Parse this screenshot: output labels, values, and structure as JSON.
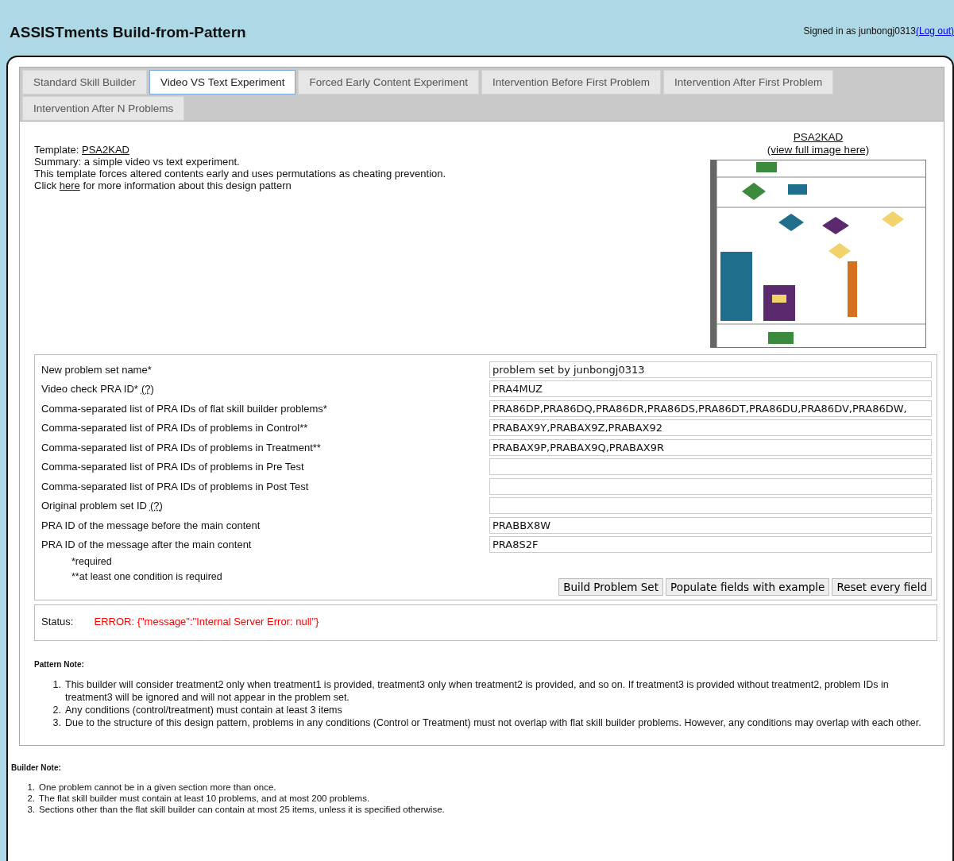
{
  "header": {
    "title": "ASSISTments Build-from-Pattern",
    "signed_in": "Signed in as junbongj0313",
    "logout": "(Log out)"
  },
  "tabs": [
    {
      "label": "Standard Skill Builder",
      "selected": false
    },
    {
      "label": "Video VS Text Experiment",
      "selected": true
    },
    {
      "label": "Forced Early Content Experiment",
      "selected": false
    },
    {
      "label": "Intervention Before First Problem",
      "selected": false
    },
    {
      "label": "Intervention After First Problem",
      "selected": false
    },
    {
      "label": "Intervention After N Problems",
      "selected": false
    }
  ],
  "template": {
    "label": "Template:",
    "name": "PSA2KAD",
    "summary": "Summary: a simple video vs text experiment.",
    "description": "This template forces altered contents early and uses permutations as cheating prevention.",
    "click_before": "Click",
    "click_link": "here",
    "click_after": "for more information about this design pattern"
  },
  "diagram": {
    "title": "PSA2KAD",
    "link": "(view full image here)",
    "kind": "picture"
  },
  "form": {
    "fields": [
      {
        "label": "New problem set name*",
        "value": "problem set by junbongj0313"
      },
      {
        "label": "Video check PRA ID*",
        "help": "(?)",
        "value": "PRA4MUZ"
      },
      {
        "label": "Comma-separated list of PRA IDs of flat skill builder problems*",
        "value": "PRA86DP,PRA86DQ,PRA86DR,PRA86DS,PRA86DT,PRA86DU,PRA86DV,PRA86DW,"
      },
      {
        "label": "Comma-separated list of PRA IDs of problems in Control**",
        "value": "PRABAX9Y,PRABAX9Z,PRABAX92"
      },
      {
        "label": "Comma-separated list of PRA IDs of problems in Treatment**",
        "value": "PRABAX9P,PRABAX9Q,PRABAX9R"
      },
      {
        "label": "Comma-separated list of PRA IDs of problems in Pre Test"
      },
      {
        "label": "Comma-separated list of PRA IDs of problems in Post Test"
      },
      {
        "label": "Original problem set ID",
        "help": "(?)"
      },
      {
        "label": "PRA ID of the message before the main content",
        "value": "PRABBX8W"
      },
      {
        "label": "PRA ID of the message after the main content",
        "value": "PRA8S2F"
      }
    ],
    "notes": [
      "*required",
      "**at least one condition is required"
    ],
    "buttons": [
      "Build Problem Set",
      "Populate fields with example",
      "Reset every field"
    ]
  },
  "status": {
    "label": "Status:",
    "message": "ERROR: {\"message\":\"Internal Server Error: null\"}"
  },
  "pattern_note": {
    "title": "Pattern Note:",
    "items": [
      {
        "number": "1.",
        "text": "This builder will consider treatment2 only when treatment1 is provided, treatment3 only when treatment2 is provided, and so on. If treatment3 is provided without treatment2, problem IDs in treatment3 will be ignored and will not appear in the problem set."
      },
      {
        "number": "2.",
        "text": "Any conditions (control/treatment) must contain at least 3 items"
      },
      {
        "number": "3.",
        "text": "Due to the structure of this design pattern, problems in any conditions (Control or Treatment) must not overlap with flat skill builder problems. However, any conditions may overlap with each other."
      }
    ]
  },
  "builder_note": {
    "title": "Builder Note:",
    "items": [
      {
        "number": "1.",
        "text": "One problem cannot be in a given section more than once."
      },
      {
        "number": "2.",
        "text": "The flat skill builder must contain at least 10 problems, and at most 200 problems."
      },
      {
        "number": "3.",
        "text": "Sections other than the flat skill builder can contain at most 25 items, unless it is specified otherwise."
      }
    ]
  }
}
